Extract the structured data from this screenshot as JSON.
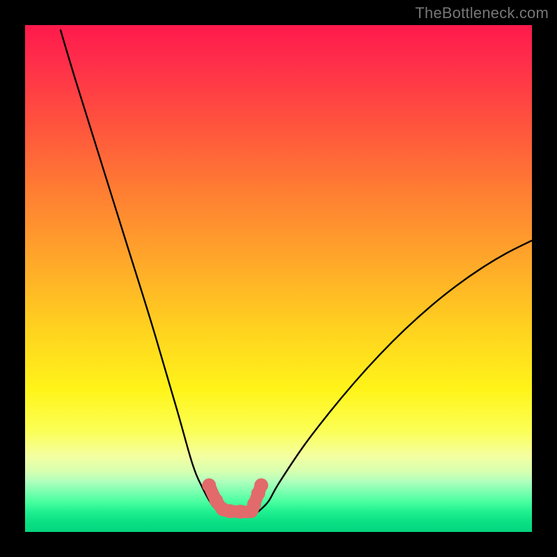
{
  "watermark": "TheBottleneck.com",
  "chart_data": {
    "type": "line",
    "title": "",
    "xlabel": "",
    "ylabel": "",
    "xlim": [
      0,
      100
    ],
    "ylim": [
      0,
      100
    ],
    "grid": false,
    "series": [
      {
        "name": "left-curve",
        "x": [
          7,
          10,
          15,
          20,
          25,
          30,
          33,
          35,
          37,
          38.5
        ],
        "values": [
          99,
          89,
          73,
          57,
          41,
          24,
          13.5,
          8.7,
          5.2,
          4.0
        ]
      },
      {
        "name": "right-curve",
        "x": [
          46,
          48,
          50,
          55,
          60,
          65,
          70,
          75,
          80,
          85,
          90,
          95,
          100
        ],
        "values": [
          4.0,
          6.0,
          9.5,
          17.0,
          23.5,
          29.5,
          35.0,
          40.0,
          44.5,
          48.5,
          52.0,
          55.0,
          57.5
        ]
      },
      {
        "name": "highlight-segment",
        "x": [
          36.3,
          37.7,
          39.0,
          40.4,
          42.5,
          44.6,
          45.2,
          46.0,
          46.6
        ],
        "values": [
          9.2,
          6.2,
          4.5,
          4.1,
          4.0,
          4.1,
          5.5,
          7.6,
          9.2
        ]
      }
    ],
    "highlight_points": {
      "name": "highlight-dots",
      "x": [
        36.3,
        37.7,
        39.0,
        40.4,
        42.5,
        44.6,
        45.2,
        46.0,
        46.6
      ],
      "values": [
        9.2,
        6.2,
        4.5,
        4.1,
        4.0,
        4.1,
        5.5,
        7.6,
        9.2
      ]
    },
    "gradient_stops": [
      {
        "pos": 0.0,
        "color": "#ff1a4b"
      },
      {
        "pos": 0.32,
        "color": "#ff7b33"
      },
      {
        "pos": 0.6,
        "color": "#ffd21f"
      },
      {
        "pos": 0.8,
        "color": "#fcff55"
      },
      {
        "pos": 0.9,
        "color": "#b0ffbc"
      },
      {
        "pos": 1.0,
        "color": "#04d67e"
      }
    ],
    "colors": {
      "curve": "#000000",
      "highlight": "#e26a6a",
      "background_frame": "#000000"
    }
  }
}
